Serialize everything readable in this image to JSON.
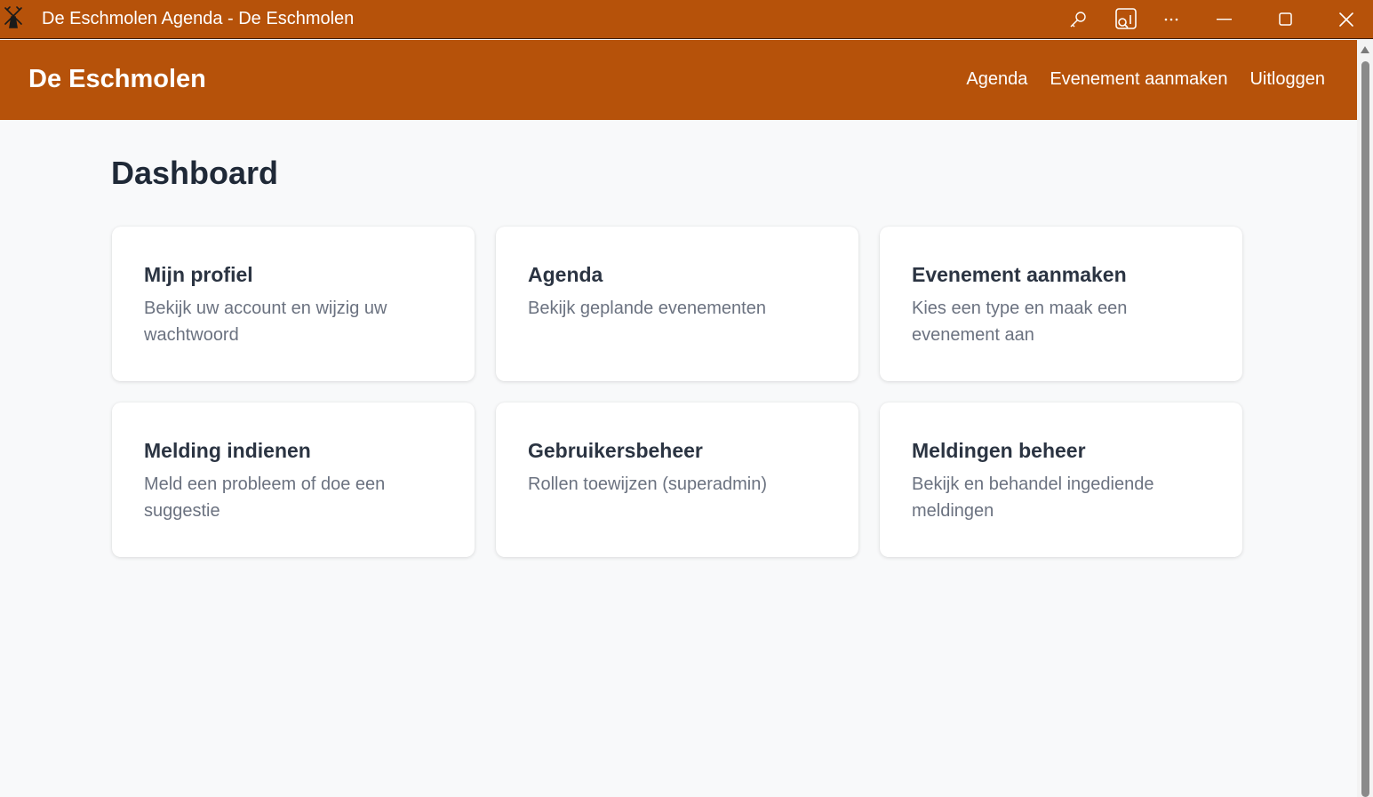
{
  "window": {
    "title": "De Eschmolen Agenda - De Eschmolen",
    "icons": [
      "windmill-icon",
      "key-icon",
      "cast-icon",
      "more-icon",
      "minimize-icon",
      "maximize-icon",
      "close-icon"
    ]
  },
  "header": {
    "brand": "De Eschmolen",
    "nav": [
      {
        "label": "Agenda"
      },
      {
        "label": "Evenement aanmaken"
      },
      {
        "label": "Uitloggen"
      }
    ],
    "background_color": "#b6520a"
  },
  "main": {
    "title": "Dashboard",
    "cards": [
      {
        "title": "Mijn profiel",
        "description": "Bekijk uw account en wijzig uw wachtwoord"
      },
      {
        "title": "Agenda",
        "description": "Bekijk geplande evenementen"
      },
      {
        "title": "Evenement aanmaken",
        "description": "Kies een type en maak een evenement aan"
      },
      {
        "title": "Melding indienen",
        "description": "Meld een probleem of doe een suggestie"
      },
      {
        "title": "Gebruikersbeheer",
        "description": "Rollen toewijzen (superadmin)"
      },
      {
        "title": "Meldingen beheer",
        "description": "Bekijk en behandel ingediende meldingen"
      }
    ]
  }
}
